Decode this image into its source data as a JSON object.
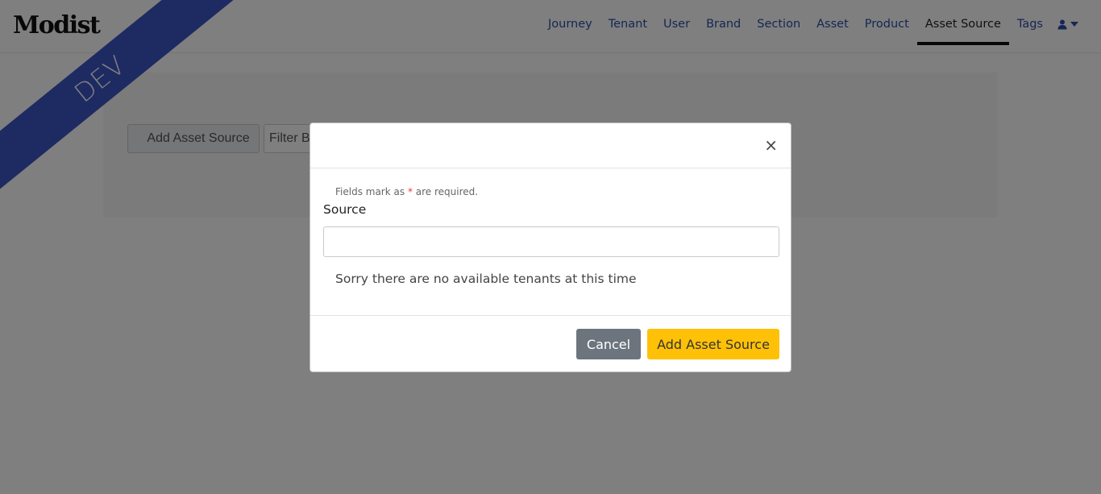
{
  "app": {
    "logo": "Modist",
    "env_ribbon": "DEV"
  },
  "nav": {
    "items": [
      {
        "label": "Journey"
      },
      {
        "label": "Tenant"
      },
      {
        "label": "User"
      },
      {
        "label": "Brand"
      },
      {
        "label": "Section"
      },
      {
        "label": "Asset"
      },
      {
        "label": "Product"
      },
      {
        "label": "Asset Source",
        "active": true
      },
      {
        "label": "Tags"
      }
    ],
    "user_menu": {
      "icon": "user-icon",
      "caret": "caret-down-icon"
    }
  },
  "page": {
    "add_button_label": "Add Asset Source",
    "filter_placeholder": "Filter By Source"
  },
  "modal": {
    "required_note_prefix": "Fields mark as ",
    "required_star": "*",
    "required_note_suffix": " are required.",
    "field_label": "Source",
    "source_value": "",
    "no_tenants_message": "Sorry there are no available tenants at this time",
    "close_glyph": "×",
    "cancel_label": "Cancel",
    "submit_label": "Add Asset Source"
  },
  "colors": {
    "ribbon": "#3d55c5",
    "nav_link": "#2a4fa8",
    "primary_button": "#ffc107",
    "secondary_button": "#6c757d"
  }
}
